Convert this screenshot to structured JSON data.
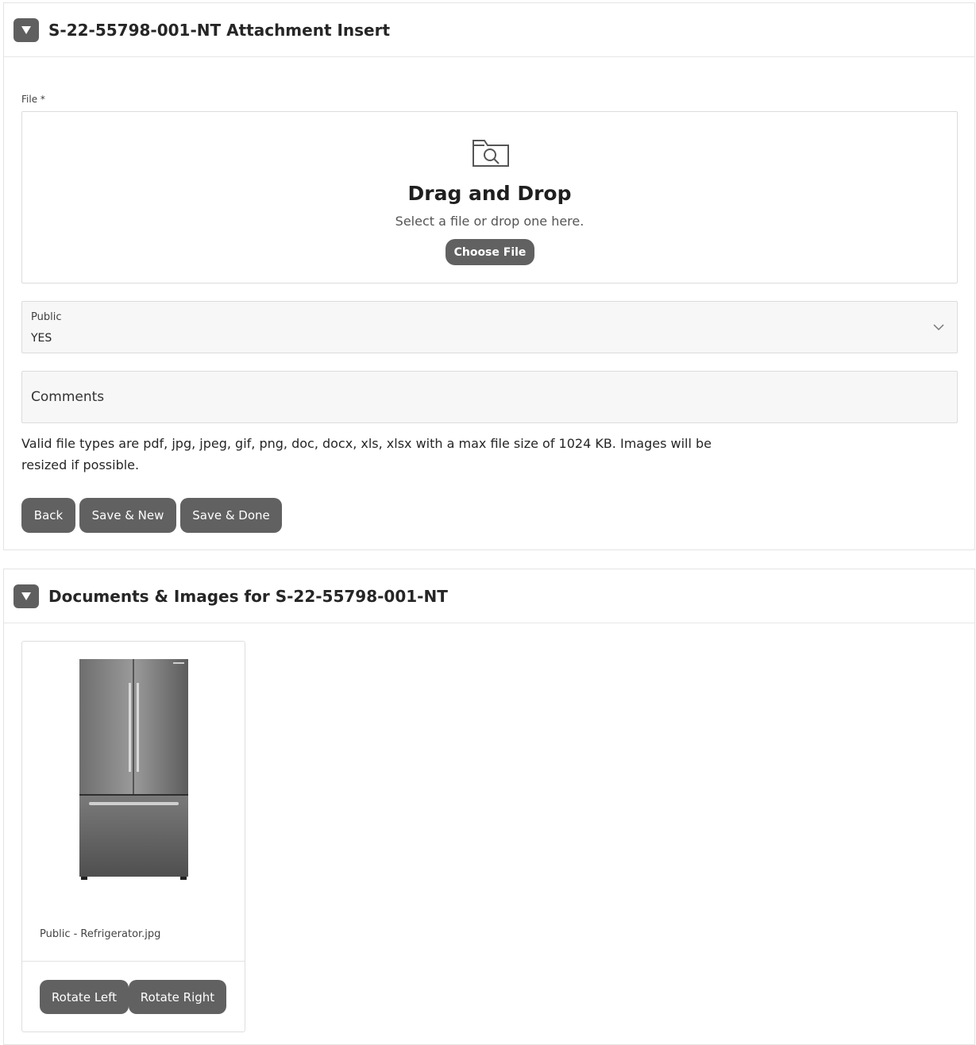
{
  "insert_region": {
    "title": "S-22-55798-001-NT Attachment Insert",
    "file_label": "File *",
    "dropzone": {
      "icon": "folder-search-icon",
      "title": "Drag and Drop",
      "subtitle": "Select a file or drop one here.",
      "button_label": "Choose File"
    },
    "public_field": {
      "label": "Public",
      "value": "YES"
    },
    "comments_field": {
      "placeholder": "Comments"
    },
    "help_text": "Valid file types are pdf, jpg, jpeg, gif, png, doc, docx, xls, xlsx with a max file size of 1024 KB. Images will be resized if possible.",
    "buttons": {
      "back": "Back",
      "save_new": "Save & New",
      "save_done": "Save & Done"
    }
  },
  "docs_region": {
    "title": "Documents & Images for S-22-55798-001-NT",
    "cards": [
      {
        "image": "refrigerator-image",
        "caption": "Public - Refrigerator.jpg",
        "rotate_left": "Rotate Left",
        "rotate_right": "Rotate Right"
      }
    ]
  },
  "colors": {
    "button_bg": "#616161",
    "field_bg": "#f7f7f7",
    "border": "#dcdcdc"
  }
}
